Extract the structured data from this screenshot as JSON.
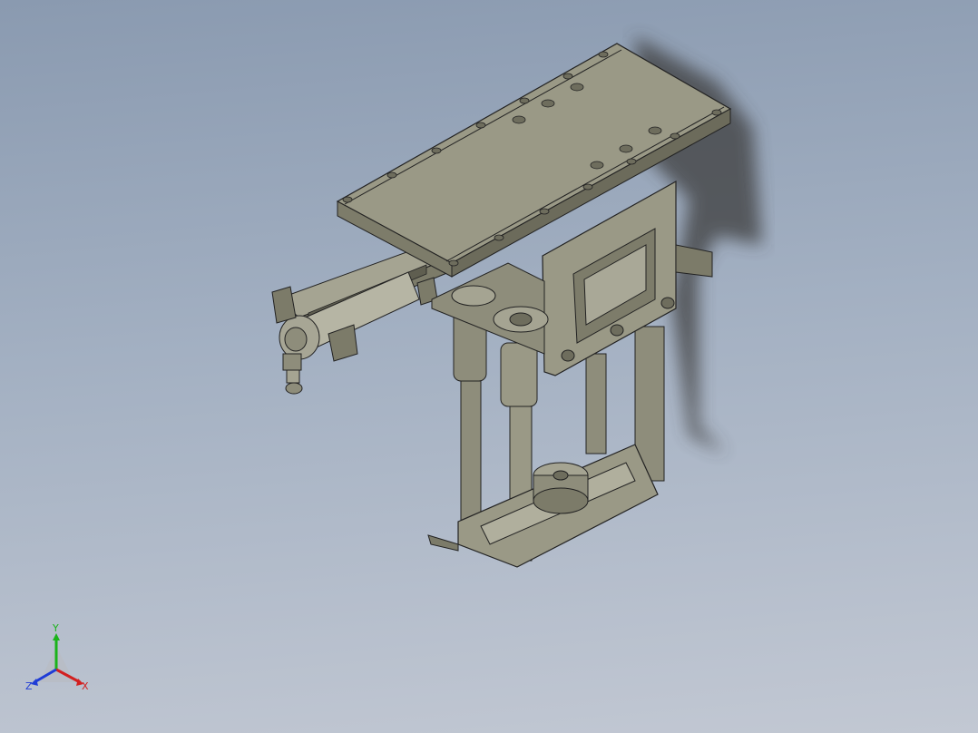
{
  "viewport": {
    "background_top": "#8a9ab0",
    "background_bottom": "#c2c8d3",
    "model_color": "#8e8d7b",
    "model_shadow_color": "#3c3c3c"
  },
  "triad": {
    "x_label": "X",
    "y_label": "Y",
    "z_label": "Z",
    "x_color": "#d22020",
    "y_color": "#1ab31a",
    "z_color": "#1f3cd6"
  }
}
